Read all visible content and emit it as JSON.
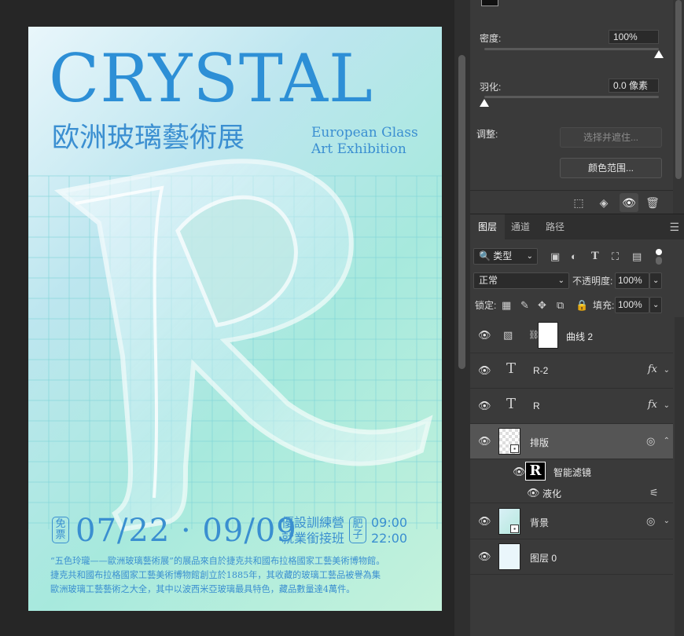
{
  "poster": {
    "title": "CRYSTAL",
    "subtitle_cn": "欧洲玻璃藝術展",
    "subtitle_en_1": "European Glass",
    "subtitle_en_2": "Art Exhibition",
    "badge_free": "免票",
    "date_range": "07/22 · 09/09",
    "event_line_1": "優設訓練營",
    "event_line_2": "就業銜接班",
    "badge_sponsor": "肥子",
    "time_1": "09:00",
    "time_2": "22:00",
    "description_1": "“五色玲瓏——歐洲玻璃藝術展”的展品來自於捷克共和國布拉格國家工藝美術博物館。",
    "description_2": "捷克共和國布拉格國家工藝美術博物館創立於1885年，其收藏的玻璃工藝品被譽為集",
    "description_3": "歐洲玻璃工藝藝術之大全，其中以波西米亞玻璃最具特色，藏品數量達4萬件。",
    "colors": {
      "text": "#3a8fd0",
      "bg_start": "#e9f6fb",
      "bg_end": "#c4f2dc"
    }
  },
  "properties": {
    "density_label": "密度:",
    "density_value": "100%",
    "density_level": 1.0,
    "feather_label": "羽化:",
    "feather_value": "0.0 像素",
    "feather_level": 0.0,
    "adjust_label": "调整:",
    "select_and_mask": "选择并遮住...",
    "color_range": "颜色范围..."
  },
  "layers_panel": {
    "tabs": [
      "图层",
      "通道",
      "路径"
    ],
    "active_tab": 0,
    "filter_kind": "类型",
    "blend_mode": "正常",
    "opacity_label": "不透明度:",
    "opacity_value": "100%",
    "lock_label": "锁定:",
    "fill_label": "填充:",
    "fill_value": "100%",
    "layers": [
      {
        "name": "曲线 2",
        "kind": "adjustment"
      },
      {
        "name": "R-2",
        "kind": "text",
        "fx": "fx"
      },
      {
        "name": "R",
        "kind": "text",
        "fx": "fx"
      },
      {
        "name": "排版",
        "kind": "smart",
        "selected": true
      },
      {
        "name": "智能滤镜",
        "kind": "smart-filter"
      },
      {
        "name": "液化",
        "kind": "filter"
      },
      {
        "name": "背景",
        "kind": "smart"
      },
      {
        "name": "图层 0",
        "kind": "pixel"
      }
    ]
  }
}
